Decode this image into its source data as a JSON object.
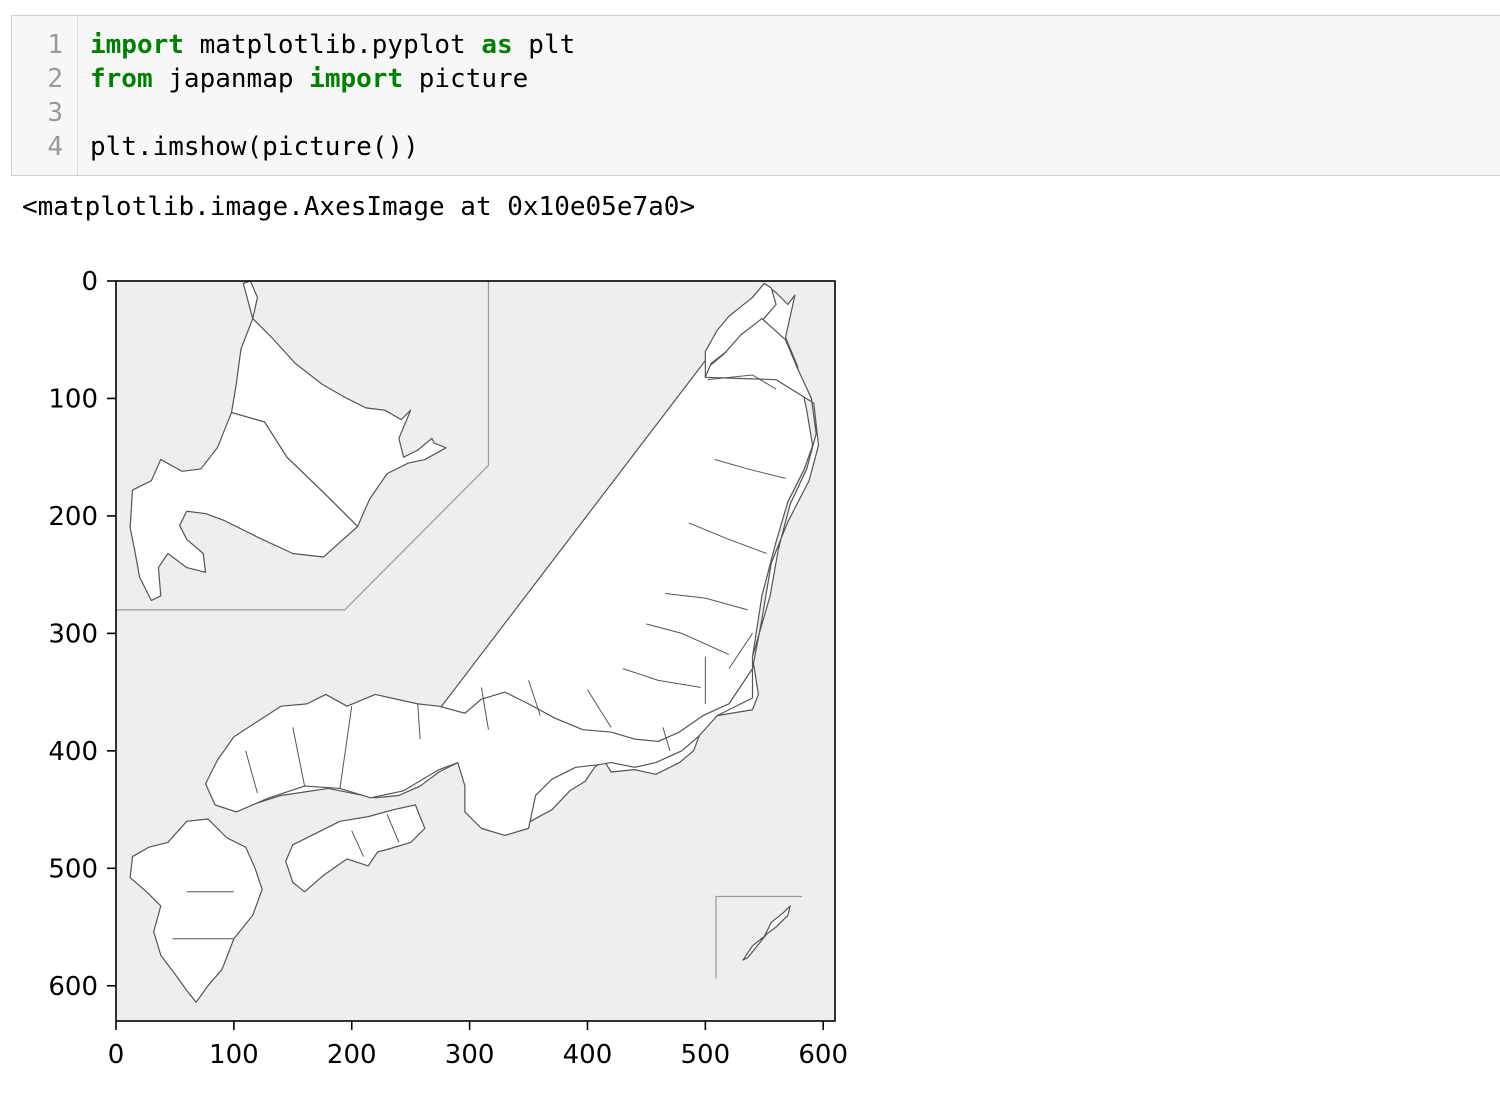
{
  "notebook": {
    "cell": {
      "line_numbers": [
        "1",
        "2",
        "3",
        "4"
      ],
      "lines": [
        [
          {
            "t": "import",
            "kw": true
          },
          {
            "t": " matplotlib.pyplot ",
            "kw": false
          },
          {
            "t": "as",
            "kw": true
          },
          {
            "t": " plt",
            "kw": false
          }
        ],
        [
          {
            "t": "from",
            "kw": true
          },
          {
            "t": " japanmap ",
            "kw": false
          },
          {
            "t": "import",
            "kw": true
          },
          {
            "t": " picture",
            "kw": false
          }
        ],
        [],
        [
          {
            "t": "plt.imshow(picture())",
            "kw": false
          }
        ]
      ]
    },
    "output": {
      "repr": "<matplotlib.image.AxesImage at 0x10e05e7a0>"
    }
  },
  "chart_data": {
    "type": "image",
    "title": "",
    "xlabel": "",
    "ylabel": "",
    "xlim": [
      0,
      610
    ],
    "ylim": [
      630,
      0
    ],
    "y_inverted": true,
    "xticks": [
      0,
      100,
      200,
      300,
      400,
      500,
      600
    ],
    "xtick_labels": [
      "0",
      "100",
      "200",
      "300",
      "400",
      "500",
      "600"
    ],
    "yticks": [
      0,
      100,
      200,
      300,
      400,
      500,
      600
    ],
    "ytick_labels": [
      "0",
      "100",
      "200",
      "300",
      "400",
      "500",
      "600"
    ],
    "grid": false,
    "image_content": "japan-prefecture-map",
    "background_color": "#eeeeee",
    "land_color": "#ffffff",
    "border_color": "#555555"
  }
}
